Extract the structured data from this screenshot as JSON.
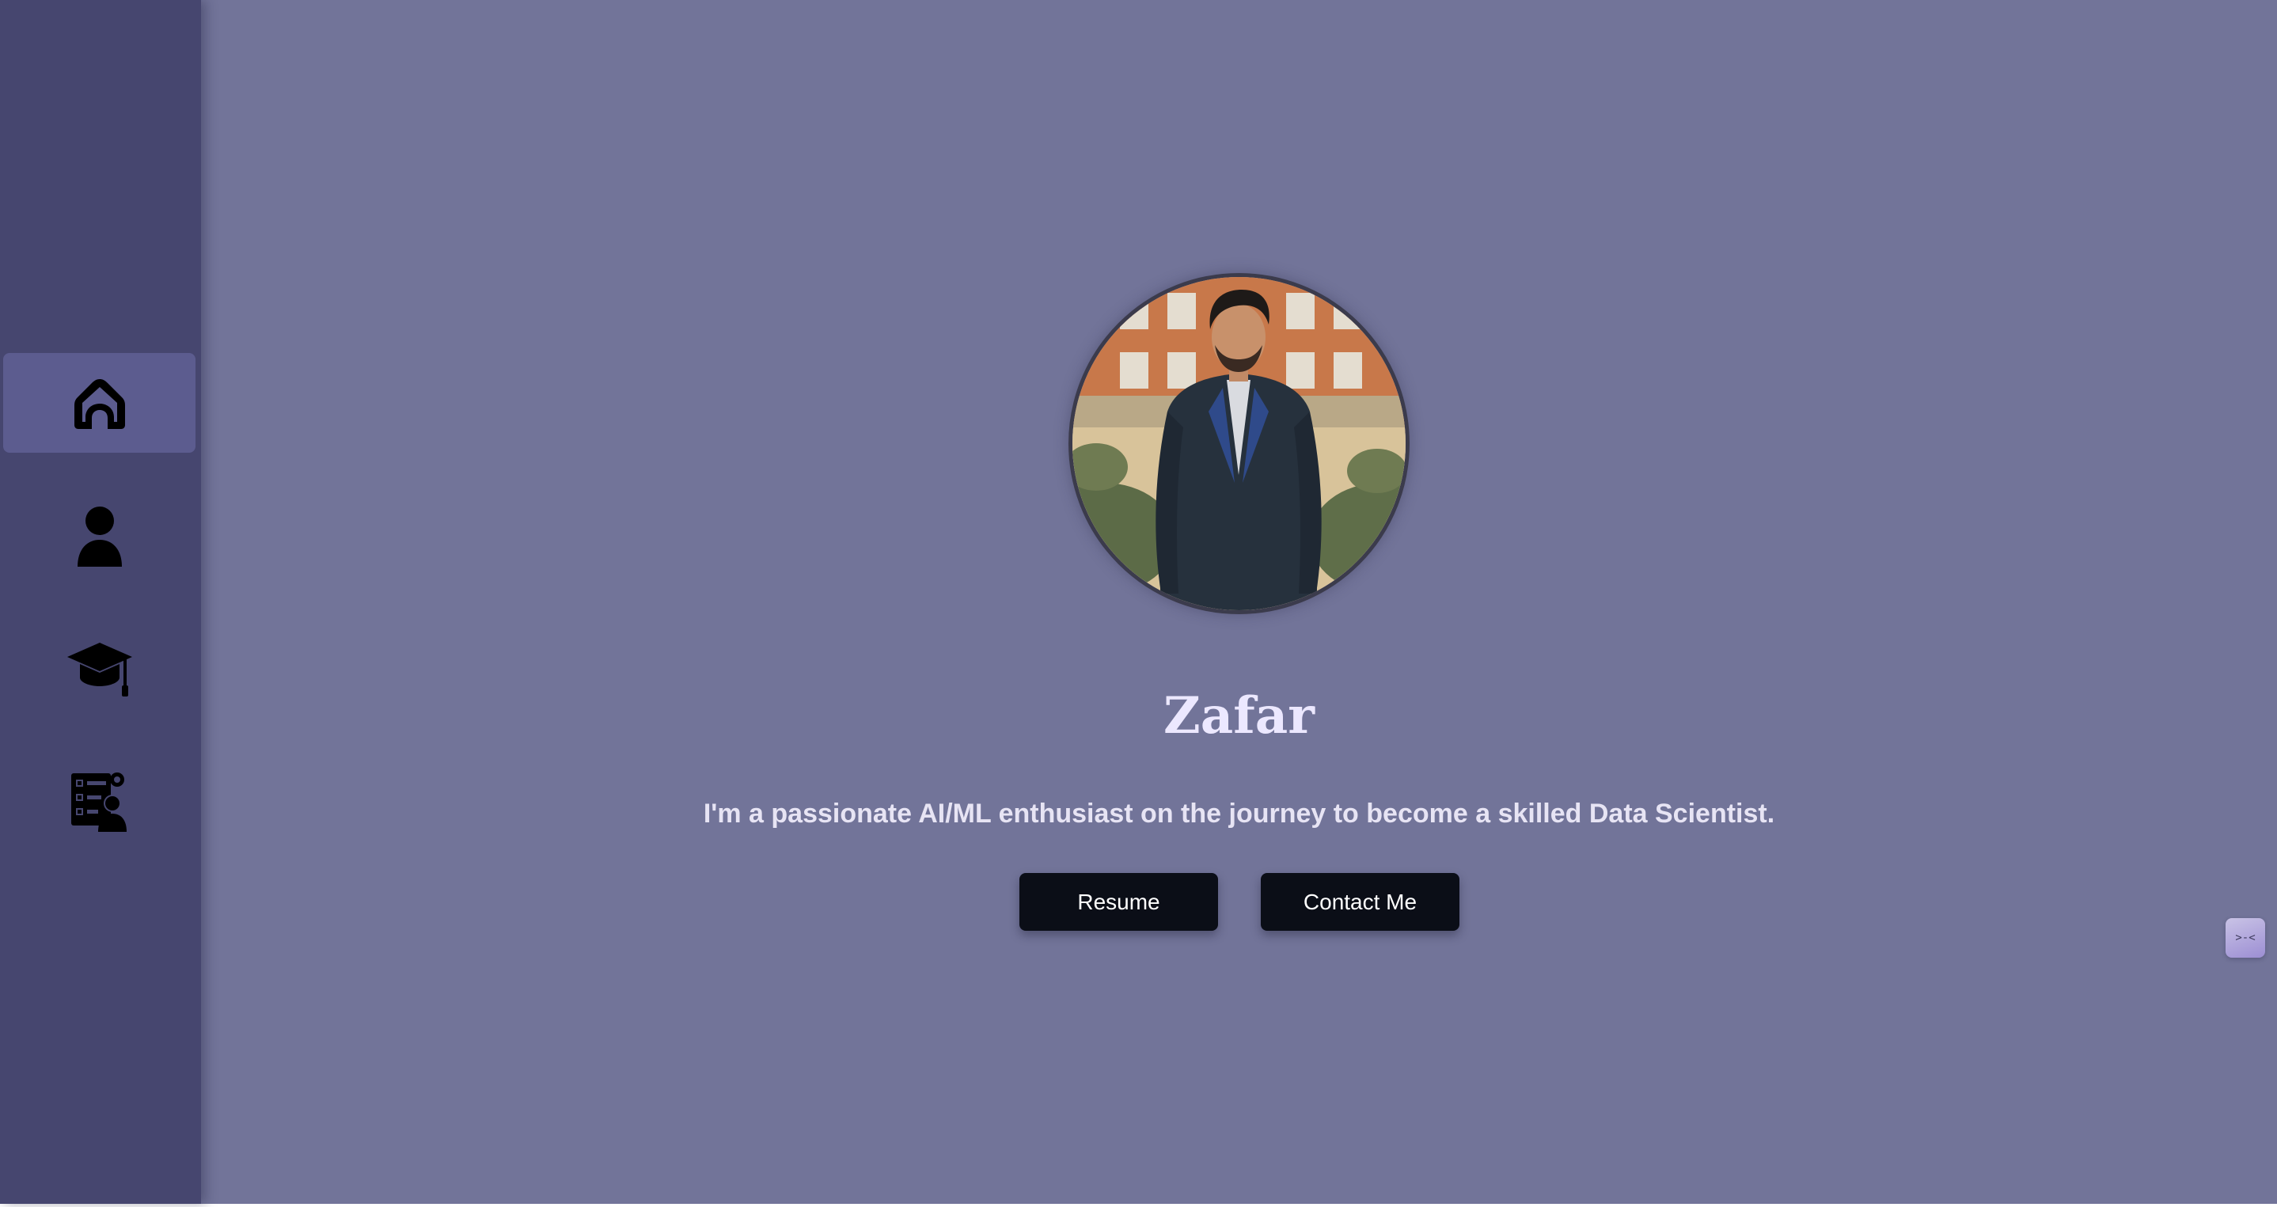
{
  "colors": {
    "page_background": "#727499",
    "sidebar_background": "#46466f",
    "sidebar_active_background": "#5c5c8f",
    "button_background": "#0b0e17",
    "button_text": "#ffffff",
    "name_text": "#ece8ff",
    "tagline_text": "#e7e4f4"
  },
  "sidebar": {
    "items": [
      {
        "id": "home",
        "icon": "home-icon",
        "active": true
      },
      {
        "id": "about",
        "icon": "user-icon",
        "active": false
      },
      {
        "id": "education",
        "icon": "graduation-cap-icon",
        "active": false
      },
      {
        "id": "skills",
        "icon": "checklist-person-gear-icon",
        "active": false
      }
    ]
  },
  "hero": {
    "photo": "profile-photo",
    "name": "Zafar",
    "tagline": "I'm a passionate AI/ML enthusiast on the journey to become a skilled Data Scientist.",
    "buttons": {
      "resume_label": "Resume",
      "contact_label": "Contact Me"
    }
  },
  "chat_widget": {
    "icon": "chat-face-icon",
    "glyph": ">-<"
  }
}
